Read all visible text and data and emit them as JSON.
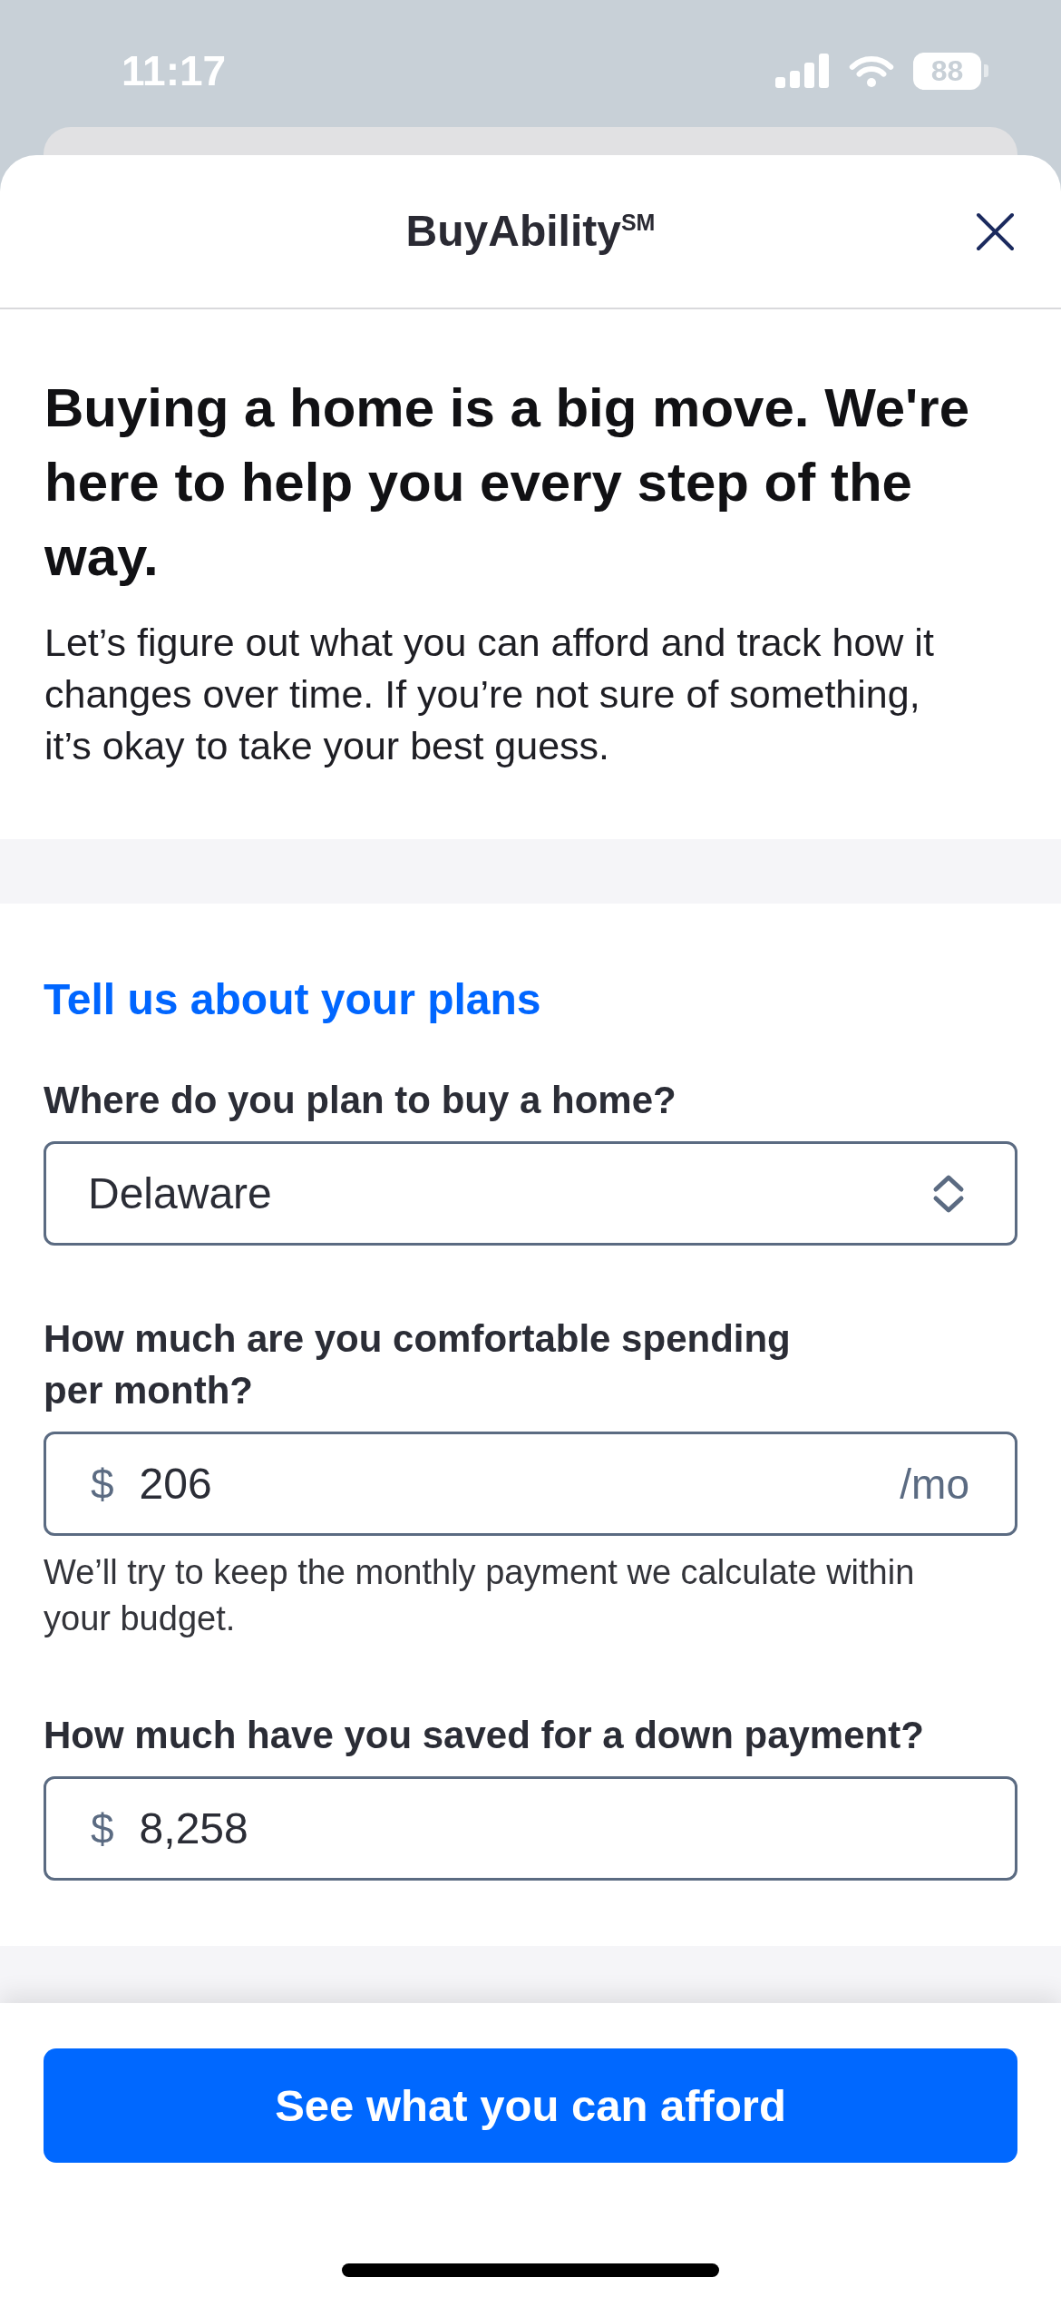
{
  "status_bar": {
    "time": "11:17",
    "battery": "88"
  },
  "sheet": {
    "title": "BuyAbility$^{SM}$"
  },
  "intro": {
    "heading": "Buying a home is a big move. We're here to help you every step of the way.",
    "body": "Let’s figure out what you can afford and track how it changes over time. If you’re not sure of something, it’s okay to take your best guess."
  },
  "form": {
    "title": "Tell us about your plans",
    "fields": [
      {
        "kind": "select",
        "label": "Where do you plan to buy a home?",
        "value": "Delaware"
      },
      {
        "kind": "currency",
        "label": "How much are you comfortable spending per month?",
        "prefix": "$",
        "value": "206",
        "suffix": "/mo",
        "helper": "We’ll try to keep the monthly payment we calculate within your budget."
      },
      {
        "kind": "currency",
        "label": "How much have you saved for a down payment?",
        "prefix": "$",
        "value": "8,258"
      }
    ]
  },
  "footer": {
    "button": "See what you can afford"
  }
}
